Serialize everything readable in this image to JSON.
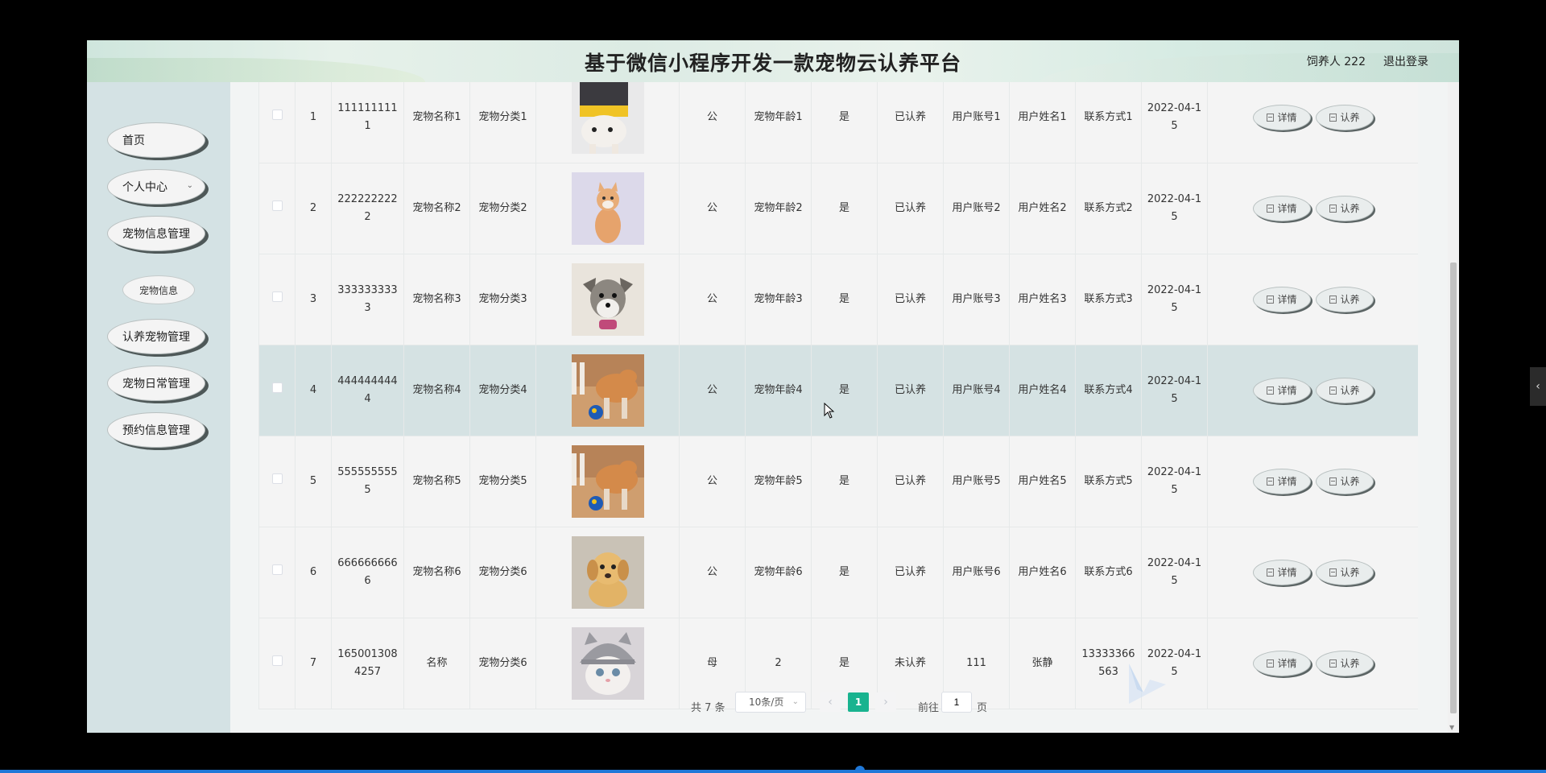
{
  "header": {
    "title": "基于微信小程序开发一款宠物云认养平台",
    "user_label": "饲养人 222",
    "logout": "退出登录"
  },
  "sidebar": {
    "items": [
      {
        "label": "首页"
      },
      {
        "label": "个人中心"
      },
      {
        "label": "宠物信息管理"
      },
      {
        "label": "认养宠物管理"
      },
      {
        "label": "宠物日常管理"
      },
      {
        "label": "预约信息管理"
      }
    ],
    "sub_item": "宠物信息"
  },
  "table": {
    "rows": [
      {
        "index": "1",
        "code": "1111111111",
        "name": "宠物名称1",
        "category": "宠物分类1",
        "gender": "公",
        "age": "宠物年龄1",
        "flag": "是",
        "status": "已认养",
        "account": "用户账号1",
        "username": "用户姓名1",
        "contact": "联系方式1",
        "date": "2022-04-15",
        "image": "dog-1"
      },
      {
        "index": "2",
        "code": "2222222222",
        "name": "宠物名称2",
        "category": "宠物分类2",
        "gender": "公",
        "age": "宠物年龄2",
        "flag": "是",
        "status": "已认养",
        "account": "用户账号2",
        "username": "用户姓名2",
        "contact": "联系方式2",
        "date": "2022-04-15",
        "image": "cat-2"
      },
      {
        "index": "3",
        "code": "3333333333",
        "name": "宠物名称3",
        "category": "宠物分类3",
        "gender": "公",
        "age": "宠物年龄3",
        "flag": "是",
        "status": "已认养",
        "account": "用户账号3",
        "username": "用户姓名3",
        "contact": "联系方式3",
        "date": "2022-04-15",
        "image": "dog-3"
      },
      {
        "index": "4",
        "code": "4444444444",
        "name": "宠物名称4",
        "category": "宠物分类4",
        "gender": "公",
        "age": "宠物年龄4",
        "flag": "是",
        "status": "已认养",
        "account": "用户账号4",
        "username": "用户姓名4",
        "contact": "联系方式4",
        "date": "2022-04-15",
        "image": "dog-ball"
      },
      {
        "index": "5",
        "code": "5555555555",
        "name": "宠物名称5",
        "category": "宠物分类5",
        "gender": "公",
        "age": "宠物年龄5",
        "flag": "是",
        "status": "已认养",
        "account": "用户账号5",
        "username": "用户姓名5",
        "contact": "联系方式5",
        "date": "2022-04-15",
        "image": "dog-ball"
      },
      {
        "index": "6",
        "code": "6666666666",
        "name": "宠物名称6",
        "category": "宠物分类6",
        "gender": "公",
        "age": "宠物年龄6",
        "flag": "是",
        "status": "已认养",
        "account": "用户账号6",
        "username": "用户姓名6",
        "contact": "联系方式6",
        "date": "2022-04-15",
        "image": "puppy-6"
      },
      {
        "index": "7",
        "code": "1650013084257",
        "name": "名称",
        "category": "宠物分类6",
        "gender": "母",
        "age": "2",
        "flag": "是",
        "status": "未认养",
        "account": "111",
        "username": "张静",
        "contact": "13333366563",
        "date": "2022-04-15",
        "image": "cat-hat"
      }
    ],
    "actions": {
      "detail": "详情",
      "adopt": "认养"
    }
  },
  "pagination": {
    "total": "共 7 条",
    "page_size": "10条/页",
    "current": "1",
    "goto_label": "前往",
    "goto_value": "1",
    "goto_suffix": "页"
  },
  "colors": {
    "accent": "#19b38f",
    "highlight_row": "#d5e2e3",
    "sidebar": "#d4e2e4"
  }
}
